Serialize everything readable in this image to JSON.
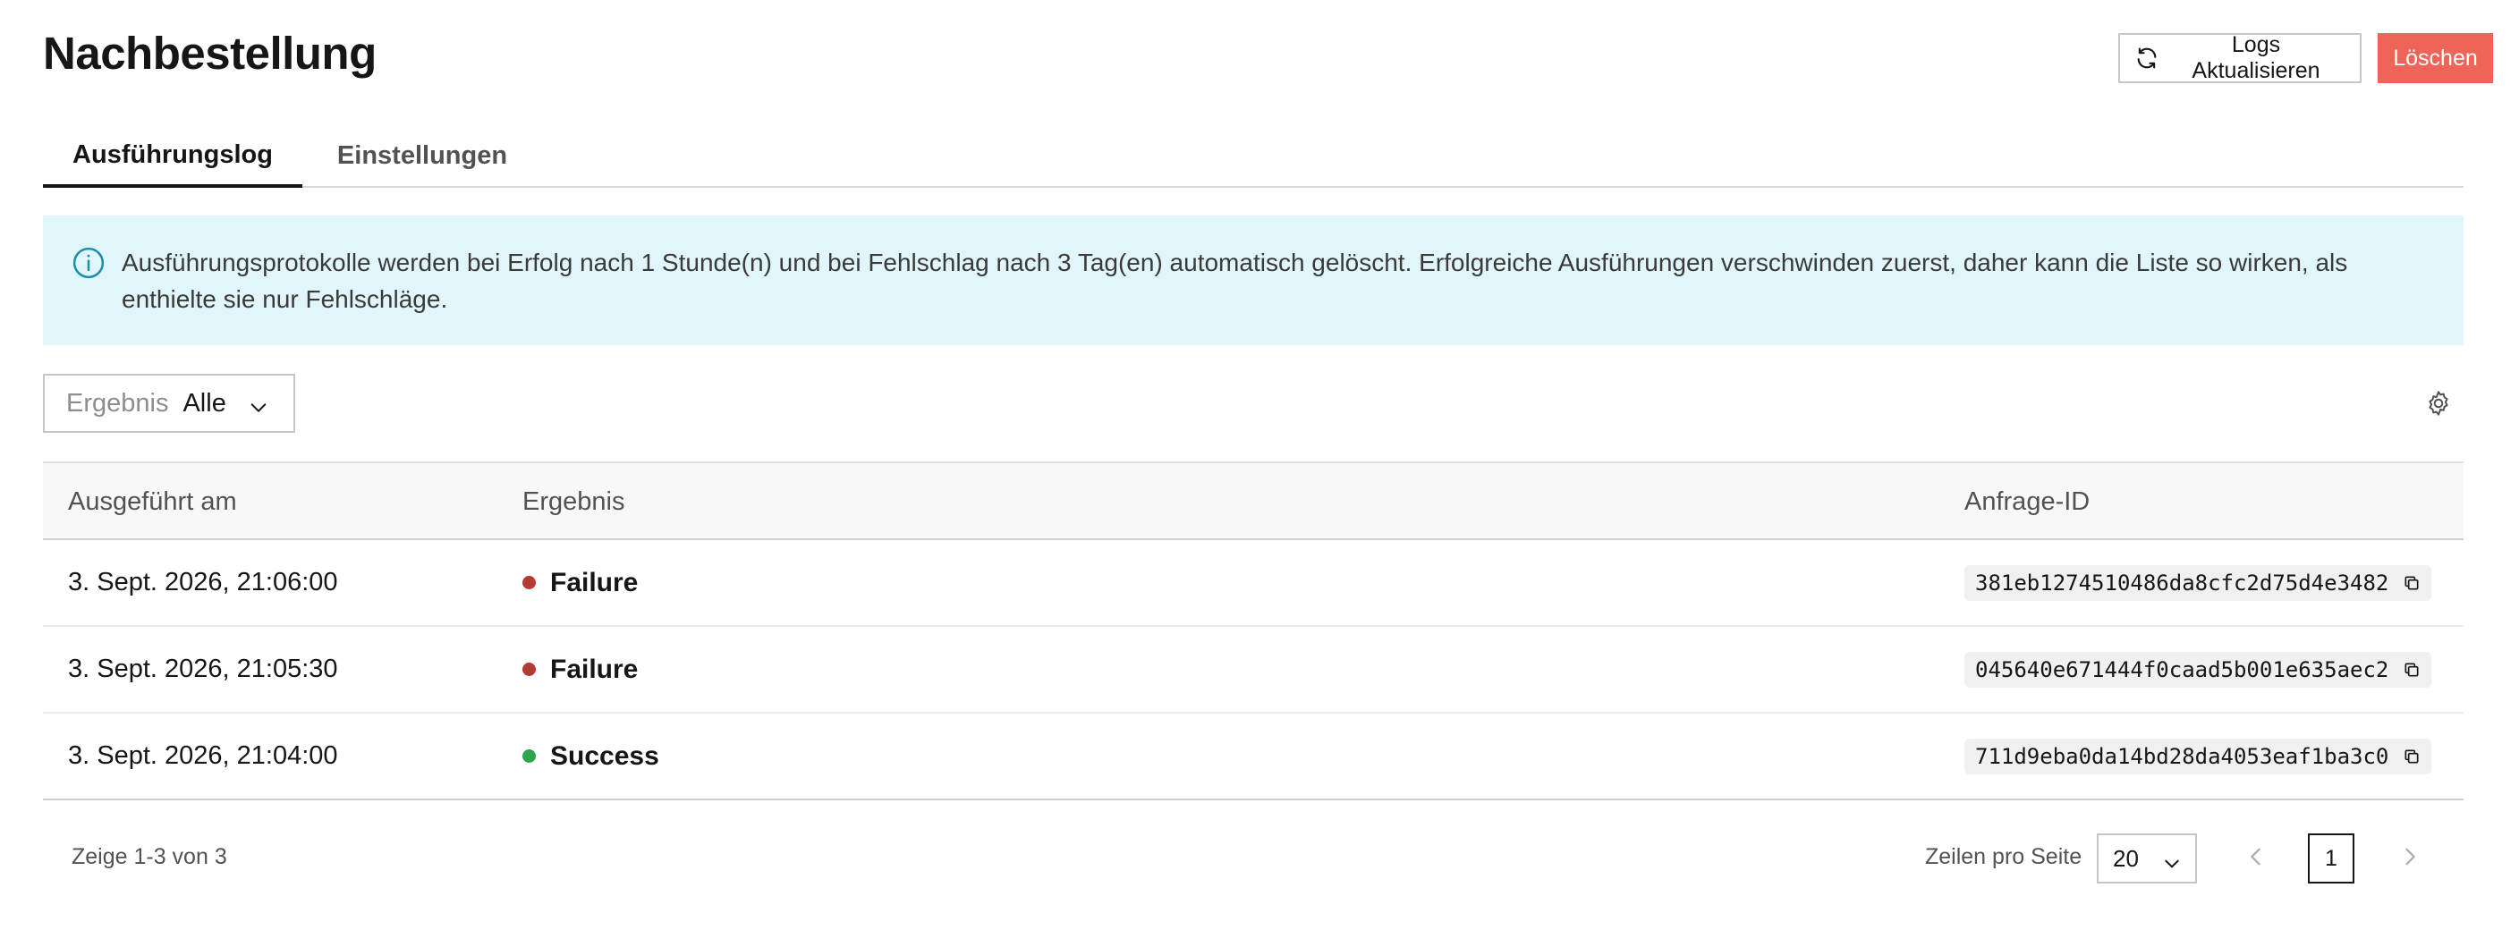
{
  "header": {
    "title": "Nachbestellung",
    "refresh_label": "Logs Aktualisieren",
    "delete_label": "Löschen"
  },
  "tabs": [
    {
      "label": "Ausführungslog",
      "active": true
    },
    {
      "label": "Einstellungen",
      "active": false
    }
  ],
  "notice": {
    "icon": "info-icon",
    "text": "Ausführungsprotokolle werden bei Erfolg nach 1 Stunde(n) und bei Fehlschlag nach 3 Tag(en) automatisch gelöscht. Erfolgreiche Ausführungen verschwinden zuerst, daher kann die Liste so wirken, als enthielte sie nur Fehlschläge."
  },
  "filter": {
    "label": "Ergebnis",
    "value": "Alle"
  },
  "table": {
    "columns": [
      "Ausgeführt am",
      "Ergebnis",
      "Anfrage-ID"
    ],
    "rows": [
      {
        "executed_at": "3. Sept. 2026, 21:06:00",
        "result": "Failure",
        "status_color": "#b23b36",
        "request_id": "381eb1274510486da8cfc2d75d4e3482"
      },
      {
        "executed_at": "3. Sept. 2026, 21:05:30",
        "result": "Failure",
        "status_color": "#b23b36",
        "request_id": "045640e671444f0caad5b001e635aec2"
      },
      {
        "executed_at": "3. Sept. 2026, 21:04:00",
        "result": "Success",
        "status_color": "#2ea44f",
        "request_id": "711d9eba0da14bd28da4053eaf1ba3c0"
      }
    ]
  },
  "pagination": {
    "showing_text": "Zeige 1-3 von 3",
    "rows_per_page_label": "Zeilen pro Seite",
    "rows_per_page": "20",
    "current_page": "1"
  },
  "colors": {
    "danger": "#ee6458",
    "notice_bg": "#e1f6fb",
    "info_icon": "#1d8fa8",
    "failure": "#b23b36",
    "success": "#2ea44f"
  }
}
